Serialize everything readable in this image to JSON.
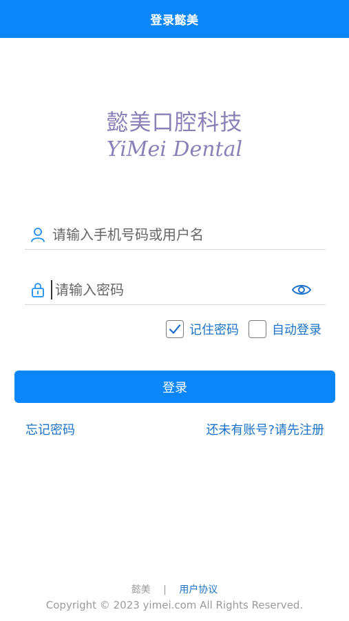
{
  "header": {
    "title": "登录懿美"
  },
  "brand": {
    "name_cn": "懿美口腔科技",
    "name_en": "YiMei Dental"
  },
  "form": {
    "username_placeholder": "请输入手机号码或用户名",
    "username_value": "",
    "password_placeholder": "请输入密码",
    "password_value": ""
  },
  "options": {
    "remember_label": "记住密码",
    "remember_checked": true,
    "auto_login_label": "自动登录",
    "auto_login_checked": false
  },
  "login_button_label": "登录",
  "links": {
    "forgot": "忘记密码",
    "register": "还未有账号?请先注册"
  },
  "footer": {
    "brand": "懿美",
    "separator": "|",
    "agreement": "用户协议",
    "copyright": "Copyright © 2023 yimei.com All Rights Reserved."
  },
  "icons": {
    "user": "user-icon",
    "lock": "lock-icon",
    "eye": "eye-icon",
    "check": "checkmark-icon"
  },
  "colors": {
    "primary": "#0a86f9",
    "brand_text": "#8a7fb6",
    "link": "#1a73c9",
    "muted": "#9a9a9a"
  }
}
